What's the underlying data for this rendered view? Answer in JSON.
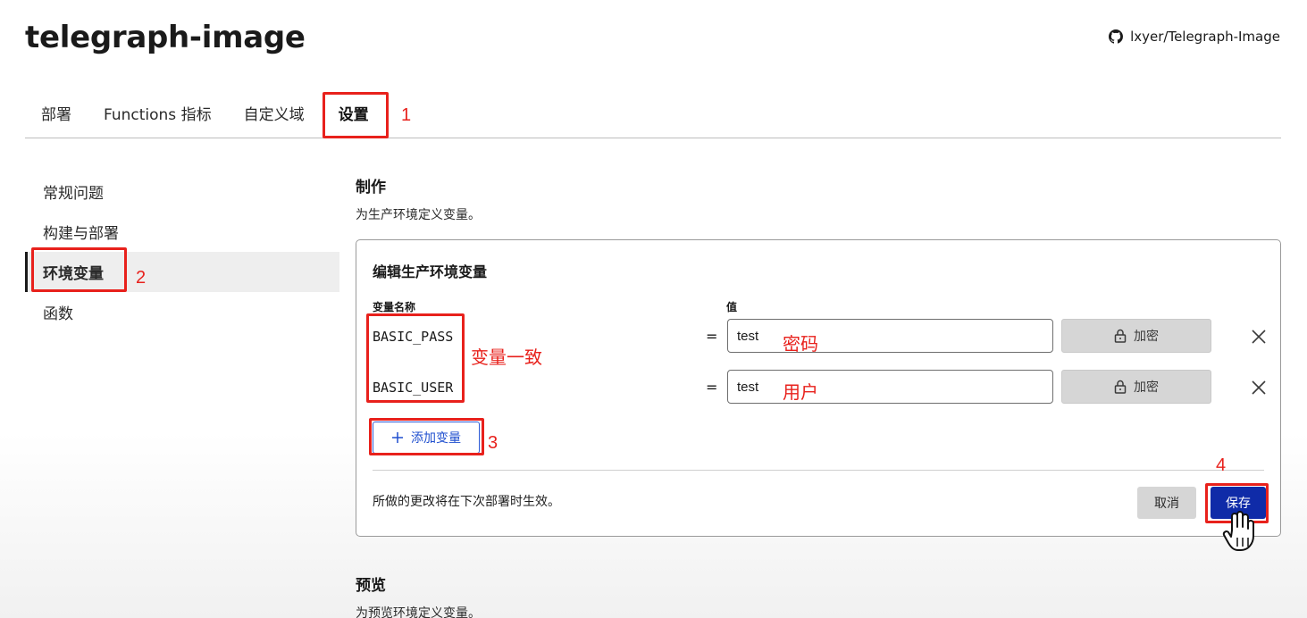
{
  "header": {
    "project_title": "telegraph-image",
    "repo_link": "lxyer/Telegraph-Image",
    "repo_icon": "github-icon"
  },
  "tabs": [
    {
      "label": "部署"
    },
    {
      "label": "Functions 指标"
    },
    {
      "label": "自定义域"
    },
    {
      "label": "设置",
      "active": true
    }
  ],
  "sidebar": {
    "items": [
      {
        "label": "常规问题"
      },
      {
        "label": "构建与部署"
      },
      {
        "label": "环境变量",
        "active": true
      },
      {
        "label": "函数"
      }
    ]
  },
  "production": {
    "title": "制作",
    "subtitle": "为生产环境定义变量。",
    "card": {
      "title": "编辑生产环境变量",
      "col_name": "变量名称",
      "col_value": "值",
      "rows": [
        {
          "name": "BASIC_PASS",
          "eq": "=",
          "value": "test",
          "encrypt_label": "加密"
        },
        {
          "name": "BASIC_USER",
          "eq": "=",
          "value": "test",
          "encrypt_label": "加密"
        }
      ],
      "add_label": "添加变量",
      "note": "所做的更改将在下次部署时生效。",
      "cancel_label": "取消",
      "save_label": "保存"
    }
  },
  "preview": {
    "title": "预览",
    "subtitle": "为预览环境定义变量。"
  },
  "annotations": {
    "n1": "1",
    "n2": "2",
    "n3": "3",
    "n4": "4",
    "same_vars": "变量一致",
    "password": "密码",
    "user": "用户"
  },
  "colors": {
    "annotation_red": "#e8211c",
    "primary_blue": "#0f2ba8",
    "link_blue": "#1f4fcf"
  }
}
